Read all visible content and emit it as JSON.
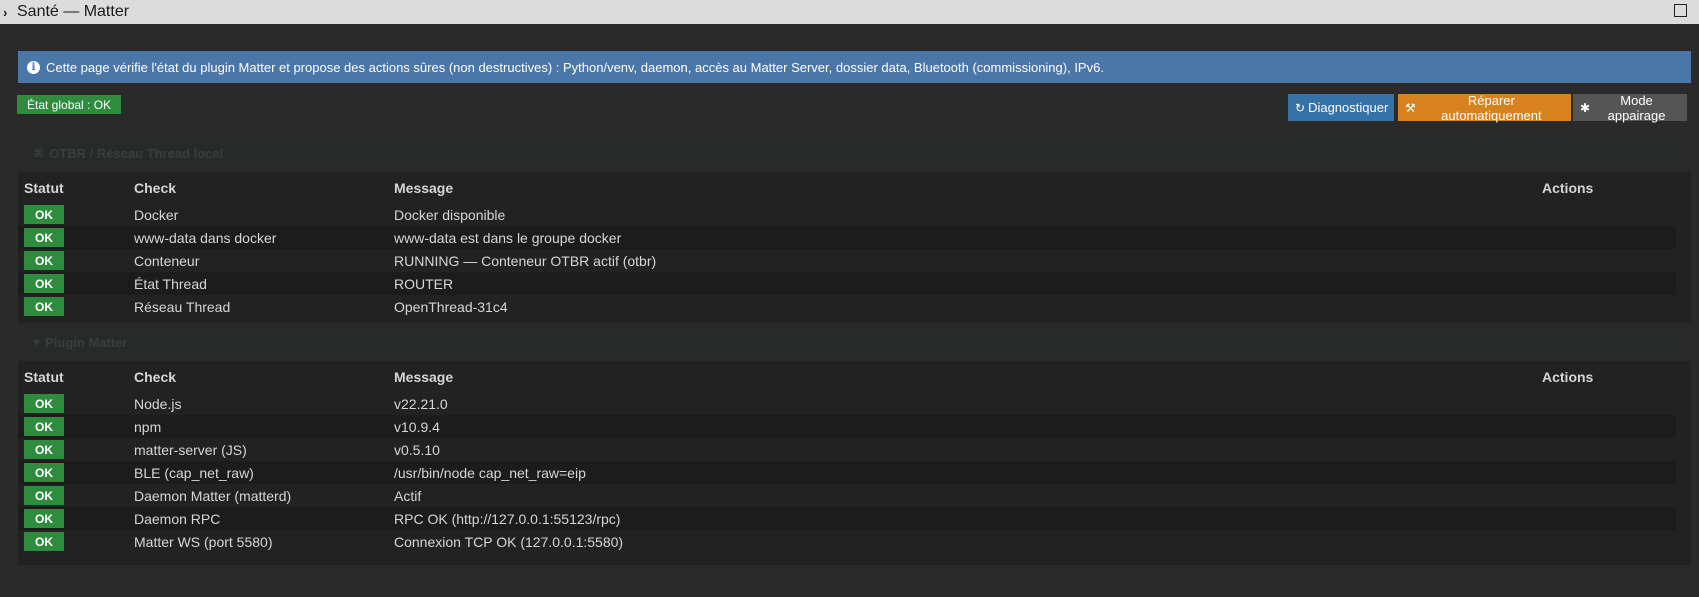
{
  "window": {
    "title": "Santé — Matter"
  },
  "info_banner": {
    "text": "Cette page vérifie l'état du plugin Matter et propose des actions sûres (non destructives) : Python/venv, daemon, accès au Matter Server, dossier data, Bluetooth (commissioning), IPv6."
  },
  "global_status": {
    "label": "État global : OK"
  },
  "toolbar": {
    "diagnostic_label": "Diagnostiquer",
    "repair_label": "Réparer automatiquement",
    "pairing_label": "Mode appairage"
  },
  "columns": {
    "status": "Statut",
    "check": "Check",
    "message": "Message",
    "actions": "Actions"
  },
  "panels": [
    {
      "title": "OTBR / Réseau Thread local",
      "icon": "network-icon",
      "rows": [
        {
          "status": "OK",
          "check": "Docker",
          "message": "Docker disponible"
        },
        {
          "status": "OK",
          "check": "www-data dans docker",
          "message": "www-data est dans le groupe docker"
        },
        {
          "status": "OK",
          "check": "Conteneur",
          "message": "RUNNING — Conteneur OTBR actif (otbr)"
        },
        {
          "status": "OK",
          "check": "État Thread",
          "message": "ROUTER"
        },
        {
          "status": "OK",
          "check": "Réseau Thread",
          "message": "OpenThread-31c4"
        }
      ]
    },
    {
      "title": "Plugin Matter",
      "icon": "heart-icon",
      "rows": [
        {
          "status": "OK",
          "check": "Node.js",
          "message": "v22.21.0"
        },
        {
          "status": "OK",
          "check": "npm",
          "message": "v10.9.4"
        },
        {
          "status": "OK",
          "check": "matter-server (JS)",
          "message": "v0.5.10"
        },
        {
          "status": "OK",
          "check": "BLE (cap_net_raw)",
          "message": "/usr/bin/node cap_net_raw=eip"
        },
        {
          "status": "OK",
          "check": "Daemon Matter (matterd)",
          "message": "Actif"
        },
        {
          "status": "OK",
          "check": "Daemon RPC",
          "message": "RPC OK (http://127.0.0.1:55123/rpc)"
        },
        {
          "status": "OK",
          "check": "Matter WS (port 5580)",
          "message": "Connexion TCP OK (127.0.0.1:5580)"
        }
      ]
    }
  ],
  "colors": {
    "ok": "#2f8c3f",
    "info": "#4a76a8",
    "diagnostic": "#3572a8",
    "repair": "#d8821f",
    "pairing": "#555555"
  }
}
